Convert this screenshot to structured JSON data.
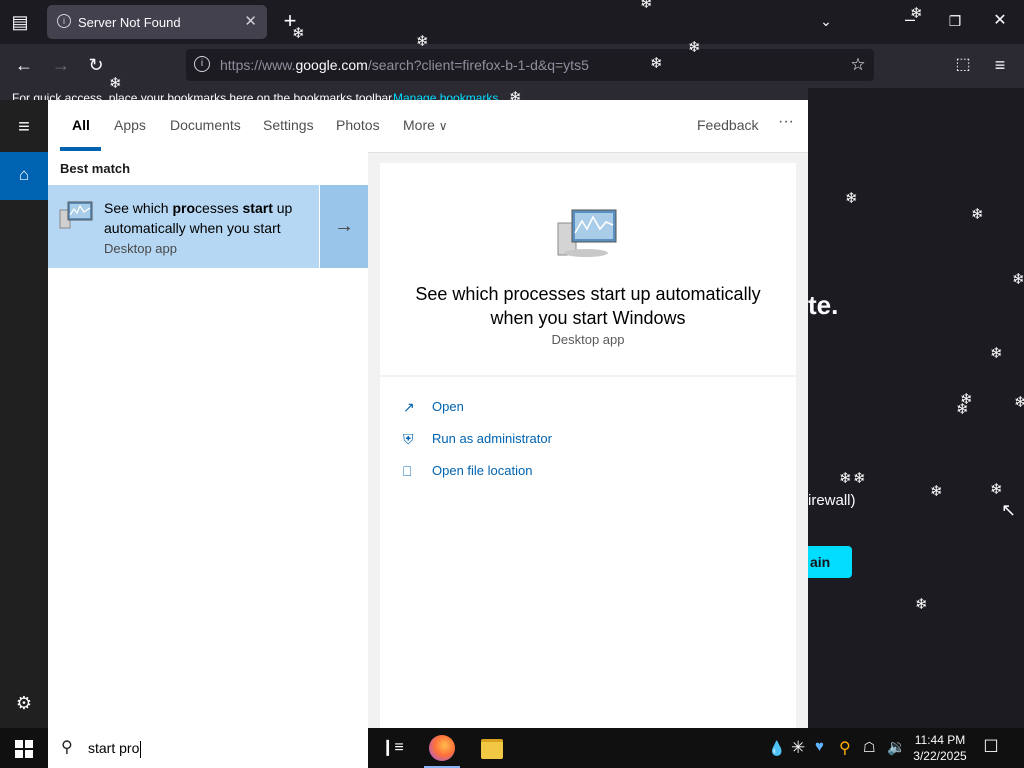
{
  "browser": {
    "tab_title": "Server Not Found",
    "url_prefix": "https://www.",
    "url_domain": "google.com",
    "url_rest": "/search?client=firefox-b-1-d&q=yts5",
    "bookmarks_text": "For quick access, place your bookmarks here on the bookmarks toolbar.",
    "bookmarks_link": "Manage bookmarks"
  },
  "page_behind": {
    "heading_fragment": "te.",
    "text_fragment": "irewall)",
    "button_fragment": "ain"
  },
  "search": {
    "tabs": [
      "All",
      "Apps",
      "Documents",
      "Settings",
      "Photos",
      "More"
    ],
    "feedback": "Feedback",
    "more_dots": "···",
    "best_match_label": "Best match",
    "result_title_parts": [
      "See which ",
      "pro",
      "cesses ",
      "start",
      " up automatically when you start"
    ],
    "result_subtitle": "Desktop app",
    "detail_title": "See which processes start up automatically when you start Windows",
    "detail_subtitle": "Desktop app",
    "actions": [
      "Open",
      "Run as administrator",
      "Open file location"
    ],
    "query": "start pro"
  },
  "taskbar": {
    "time": "11:44 PM",
    "date": "3/22/2025"
  },
  "colors": {
    "accent": "#0063b1",
    "selection": "#b5d7f3",
    "browser_dark": "#1c1b22"
  }
}
